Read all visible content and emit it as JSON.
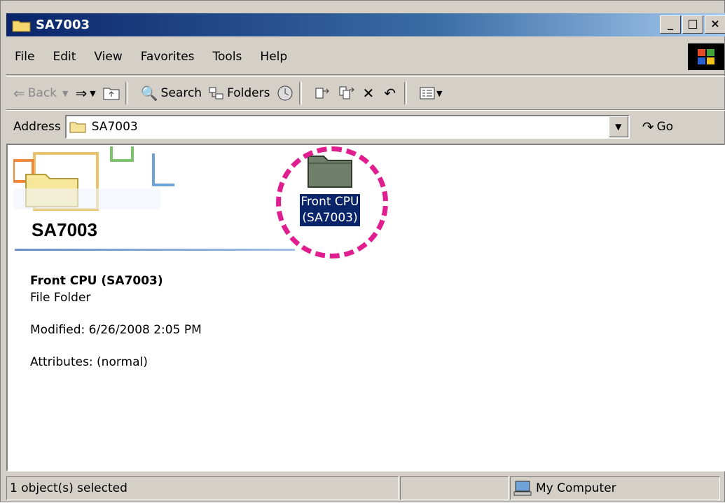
{
  "window": {
    "title": "SA7003"
  },
  "title_buttons": {
    "minimize": "_",
    "maximize": "□",
    "close": "×"
  },
  "menu": [
    "File",
    "Edit",
    "View",
    "Favorites",
    "Tools",
    "Help"
  ],
  "toolbar": {
    "back": "Back",
    "search": "Search",
    "folders": "Folders"
  },
  "address": {
    "label": "Address",
    "value": "SA7003",
    "go": "Go"
  },
  "content": {
    "folder_title": "SA7003",
    "selected_item": {
      "line1": "Front CPU",
      "line2": "(SA7003)"
    },
    "details": {
      "name": "Front CPU (SA7003)",
      "type": "File Folder",
      "modified": "Modified: 6/26/2008 2:05 PM",
      "attributes": "Attributes: (normal)"
    }
  },
  "status": {
    "left": "1 object(s) selected",
    "right": "My Computer"
  },
  "colors": {
    "highlight_circle": "#e01e8f",
    "selection": "#0a246a",
    "titlebar": "#0a246a"
  }
}
